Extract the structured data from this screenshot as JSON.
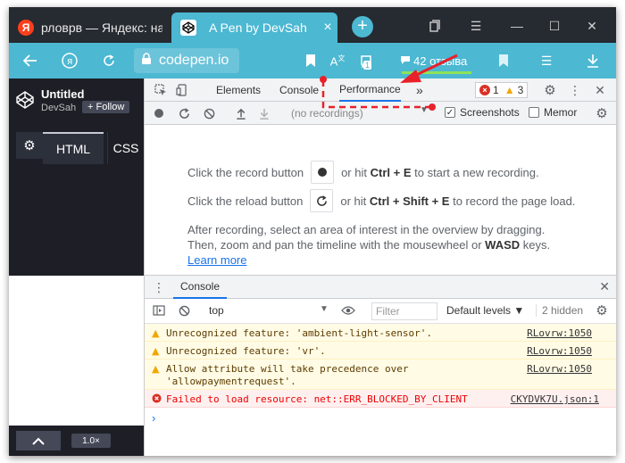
{
  "browser": {
    "tabs": [
      {
        "title": "рловрв — Яндекс: наш",
        "favicon": "Я"
      },
      {
        "title": "A Pen by DevSah"
      }
    ],
    "url": "codepen.io",
    "reviews": "42 отзыва",
    "badge": "1"
  },
  "codepen": {
    "title": "Untitled",
    "author": "DevSah",
    "follow_label": "+ Follow",
    "tabs": [
      "HTML",
      "CSS"
    ],
    "zoom": "1.0×"
  },
  "devtools": {
    "tabs": [
      "Elements",
      "Console",
      "Performance"
    ],
    "more": "»",
    "errors_count": "1",
    "warnings_count": "3",
    "recordings_placeholder": "(no recordings)",
    "screenshots_label": "Screenshots",
    "memory_label": "Memor",
    "perf": {
      "line1_pre": "Click the record button",
      "line1_mid": "or hit",
      "line1_key": "Ctrl + E",
      "line1_post": "to start a new recording.",
      "line2_pre": "Click the reload button",
      "line2_mid": "or hit",
      "line2_key": "Ctrl + Shift + E",
      "line2_post": "to record the page load.",
      "line3": "After recording, select an area of interest in the overview by dragging.",
      "line4_pre": "Then, zoom and pan the timeline with the mousewheel or",
      "line4_key": "WASD",
      "line4_post": "keys.",
      "learn_more": "Learn more"
    },
    "drawer": {
      "tab": "Console",
      "context": "top",
      "filter_placeholder": "Filter",
      "levels": "Default levels ▼",
      "hidden": "2 hidden",
      "messages": [
        {
          "type": "warn",
          "text": "Unrecognized feature: 'ambient-light-sensor'.",
          "source": "RLovrw:1050"
        },
        {
          "type": "warn",
          "text": "Unrecognized feature: 'vr'.",
          "source": "RLovrw:1050"
        },
        {
          "type": "warn",
          "text": "Allow attribute will take precedence over 'allowpaymentrequest'.",
          "source": "RLovrw:1050"
        },
        {
          "type": "error",
          "text": "Failed to load resource: net::ERR_BLOCKED_BY_CLIENT",
          "source": "CKYDVK7U.json:1"
        }
      ],
      "prompt": "›"
    }
  },
  "colors": {
    "accent": "#4cb8d2",
    "tabstrip": "#262a31",
    "annotation": "#e8202a"
  }
}
